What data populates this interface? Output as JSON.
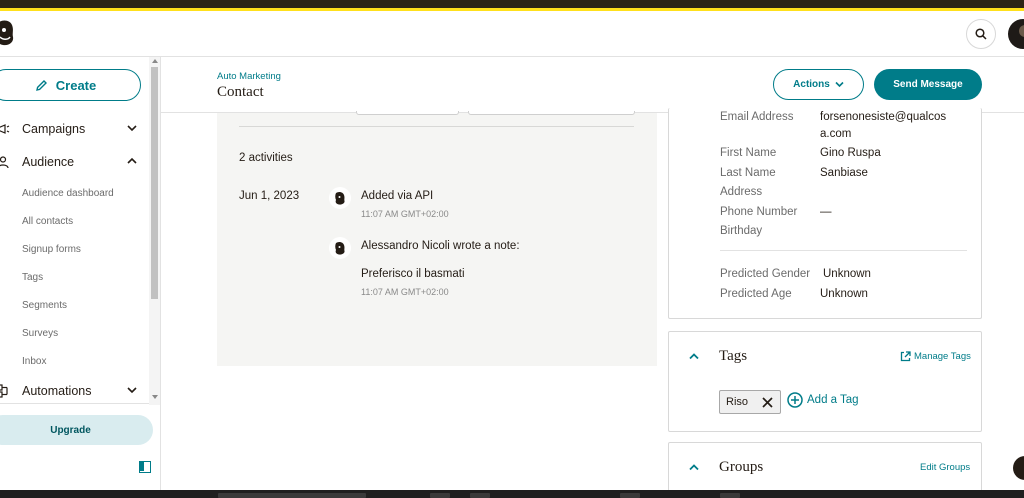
{
  "header": {
    "logo": "mailchimp-logo",
    "search_icon": "search-icon",
    "avatar": "user-avatar"
  },
  "sidebar": {
    "create_label": "Create",
    "nav": [
      {
        "label": "Campaigns",
        "icon": "campaigns-icon",
        "expanded": false
      },
      {
        "label": "Audience",
        "icon": "audience-icon",
        "expanded": true
      },
      {
        "label": "Automations",
        "icon": "automations-icon",
        "expanded": false
      }
    ],
    "audience_items": [
      "Audience dashboard",
      "All contacts",
      "Signup forms",
      "Tags",
      "Segments",
      "Surveys",
      "Inbox"
    ],
    "upgrade_label": "Upgrade"
  },
  "page": {
    "breadcrumb": "Auto Marketing",
    "title": "Contact",
    "actions_label": "Actions",
    "send_label": "Send Message"
  },
  "activity": {
    "count_label": "2 activities",
    "date": "Jun 1, 2023",
    "items": [
      {
        "title": "Added via API",
        "time": "11:07 AM GMT+02:00"
      },
      {
        "title": "Alessandro Nicoli wrote a note:",
        "note": "Preferisco il basmati",
        "time": "11:07 AM GMT+02:00"
      }
    ]
  },
  "profile": {
    "fields": [
      {
        "label": "Email Address",
        "value_line1": "forsenonesiste@qualcos",
        "value_line2": "a.com"
      },
      {
        "label": "First Name",
        "value": "Gino Ruspa"
      },
      {
        "label": "Last Name",
        "value": "Sanbiase"
      },
      {
        "label": "Address",
        "value": ""
      },
      {
        "label": "Phone Number",
        "value": "—"
      },
      {
        "label": "Birthday",
        "value": ""
      }
    ],
    "predicted": [
      {
        "label": "Predicted Gender",
        "value": "Unknown"
      },
      {
        "label": "Predicted Age",
        "value": "Unknown"
      }
    ]
  },
  "tags": {
    "title": "Tags",
    "manage_label": "Manage Tags",
    "items": [
      "Riso"
    ],
    "add_label": "Add a Tag"
  },
  "groups": {
    "title": "Groups",
    "edit_label": "Edit Groups"
  },
  "colors": {
    "accent": "#007c89",
    "brand_yellow": "#ffe01b",
    "text": "#241c15"
  }
}
